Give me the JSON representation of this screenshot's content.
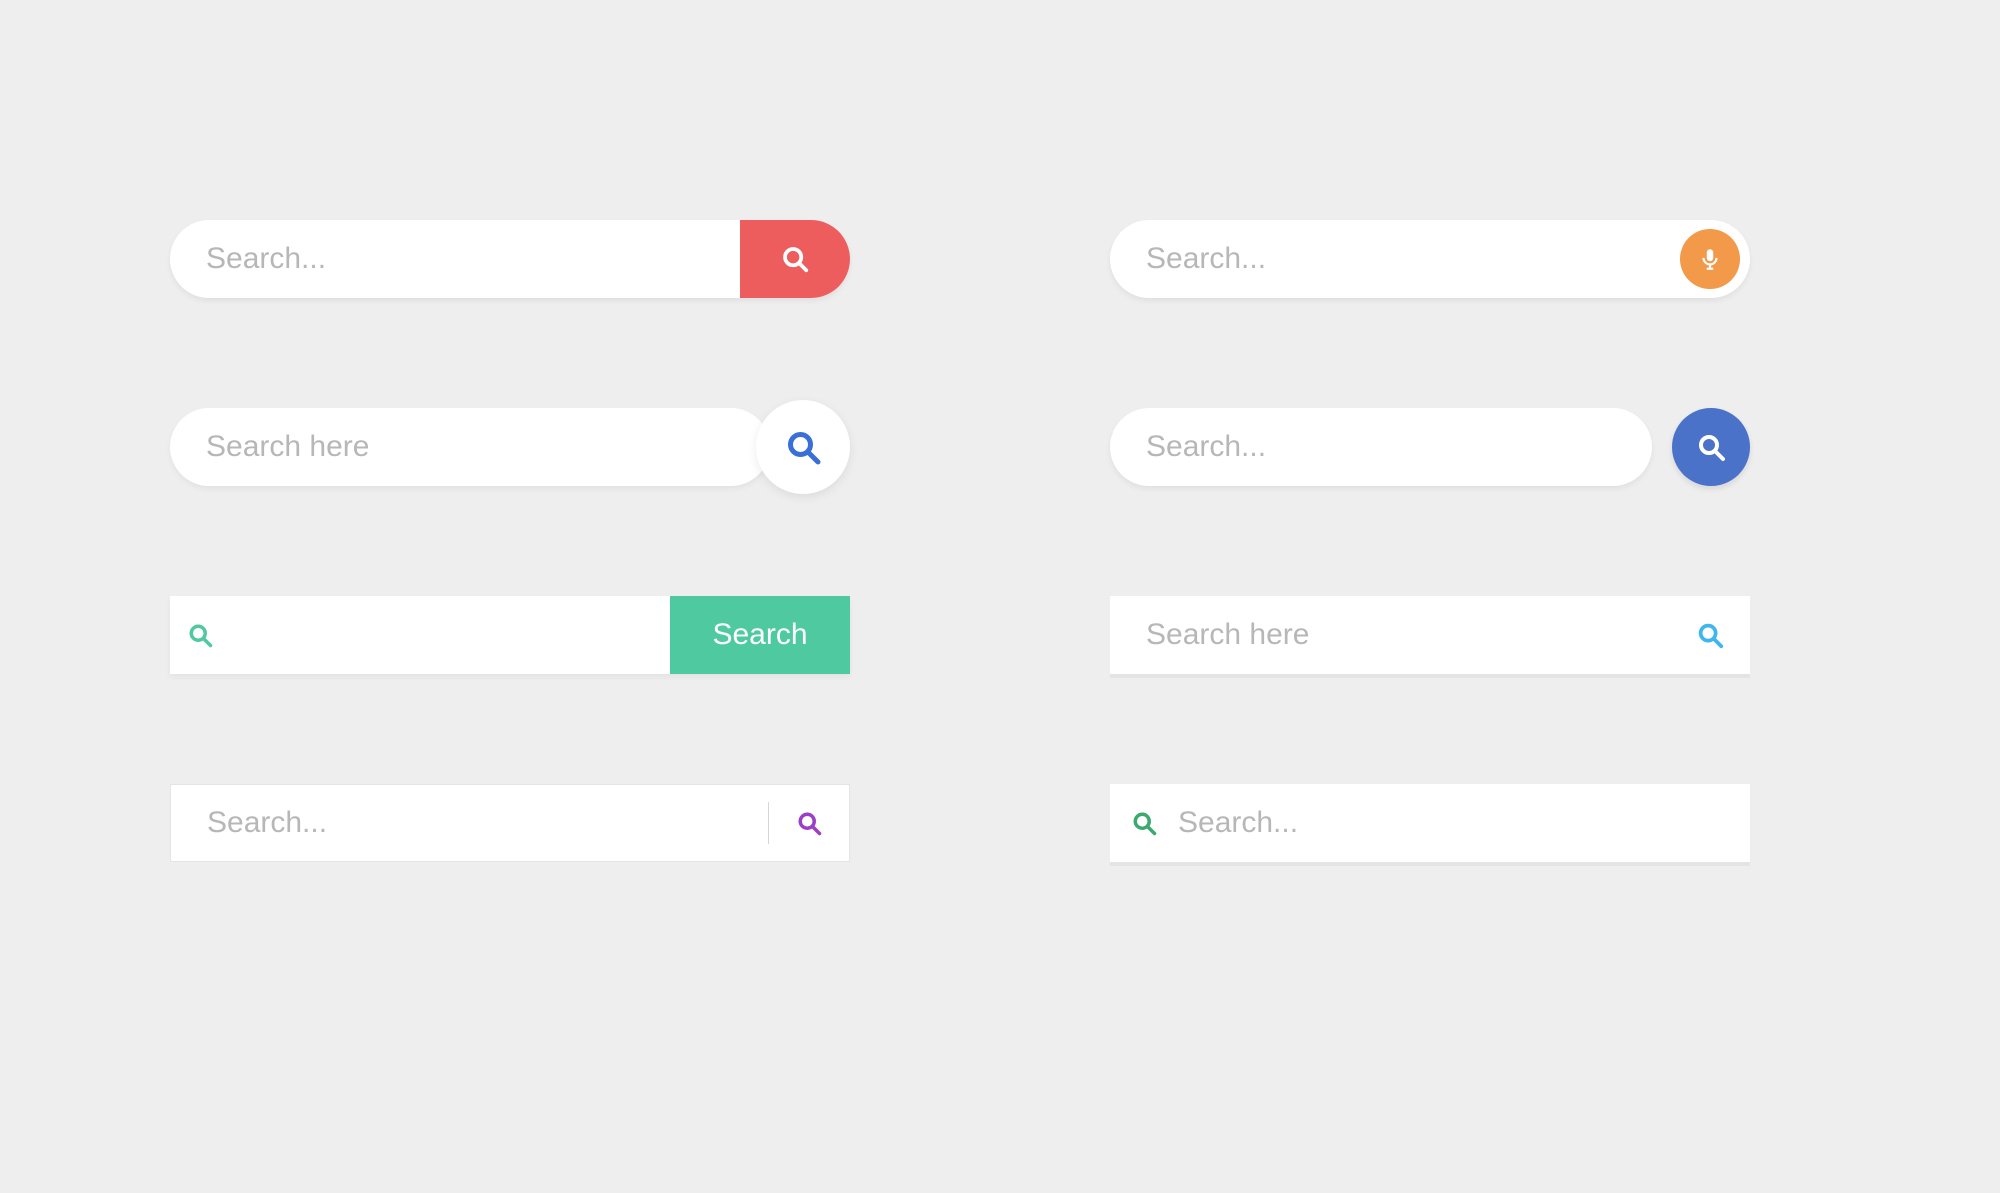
{
  "search_bars": [
    {
      "placeholder": "Search...",
      "button_color": "#ee5d5d",
      "icon": "search",
      "icon_color": "#ffffff"
    },
    {
      "placeholder": "Search here",
      "button_color": "#ffffff",
      "icon": "search",
      "icon_color": "#3a6fd8"
    },
    {
      "placeholder": "",
      "button_color": "#4ec9a0",
      "button_label": "Search",
      "icon": "search",
      "icon_color": "#4ec9a0"
    },
    {
      "placeholder": "Search...",
      "button_color": "transparent",
      "icon": "search",
      "icon_color": "#9b3fc9"
    },
    {
      "placeholder": "Search...",
      "button_color": "#f2994a",
      "icon": "microphone",
      "icon_color": "#ffffff"
    },
    {
      "placeholder": "Search...",
      "button_color": "#4a72c9",
      "icon": "search",
      "icon_color": "#ffffff"
    },
    {
      "placeholder": "Search here",
      "button_color": "transparent",
      "icon": "search",
      "icon_color": "#3fb6ee"
    },
    {
      "placeholder": "Search...",
      "button_color": "transparent",
      "icon": "search",
      "icon_color": "#3da86f"
    }
  ],
  "colors": {
    "background": "#eeeeee",
    "placeholder": "#b7b7b7",
    "white": "#ffffff"
  }
}
